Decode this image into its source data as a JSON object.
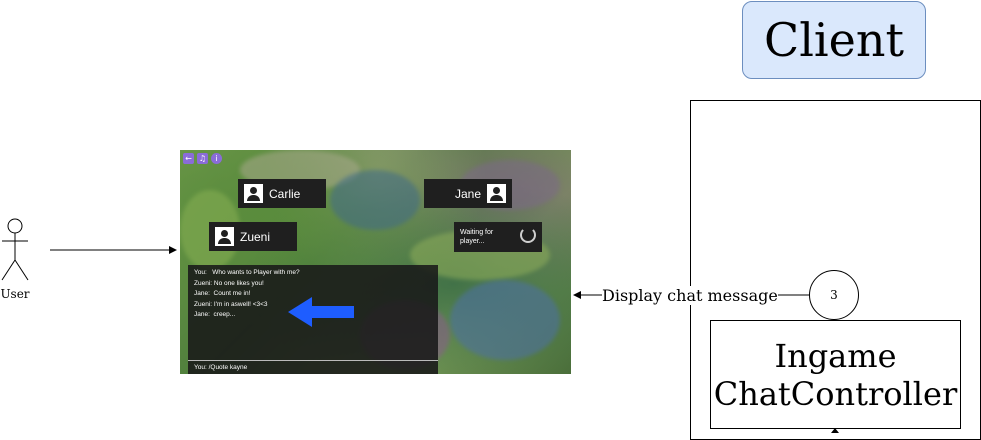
{
  "actor": {
    "label": "User"
  },
  "client": {
    "title": "Client"
  },
  "controller": {
    "line1": "Ingame",
    "line2": "ChatController"
  },
  "step": {
    "number": "3"
  },
  "edge": {
    "label": "Display chat message"
  },
  "game": {
    "top_icons": [
      "back-icon",
      "music-icon",
      "info-icon"
    ],
    "players": [
      {
        "name": "Carlie"
      },
      {
        "name": "Jane"
      },
      {
        "name": "Zueni"
      }
    ],
    "waiting": {
      "line1": "Waiting for",
      "line2": "player..."
    },
    "chat": {
      "messages": [
        {
          "sender": "You:",
          "text": "Who wants to Player with me?"
        },
        {
          "sender": "Zueni:",
          "text": "No one likes you!"
        },
        {
          "sender": "Jane:",
          "text": "Count me in!"
        },
        {
          "sender": "Zueni:",
          "text": "I'm in aswell! <3<3"
        },
        {
          "sender": "Jane:",
          "text": "creep..."
        }
      ],
      "input": "You: /Quote kayne"
    },
    "colors": {
      "arrow": "#1e5dff",
      "card": "#1f1f1f",
      "icon": "#8a6cd8"
    }
  },
  "colors": {
    "client_fill": "#dae8fc",
    "client_stroke": "#6c8ebf"
  }
}
